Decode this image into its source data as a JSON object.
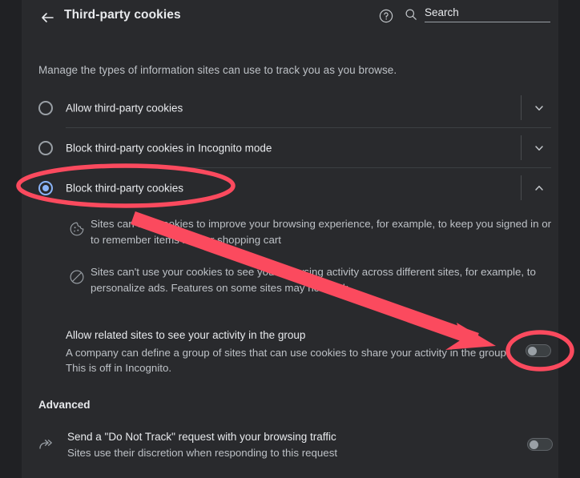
{
  "header": {
    "back_icon": "back-arrow-icon",
    "title": "Third-party cookies",
    "help_icon": "help-circle-icon",
    "search_icon": "search-icon",
    "search_placeholder": "Search",
    "search_value": ""
  },
  "intro": "Manage the types of information sites can use to track you as you browse.",
  "options": [
    {
      "label": "Allow third-party cookies",
      "selected": false,
      "expanded": false,
      "chevron": "chevron-down-icon"
    },
    {
      "label": "Block third-party cookies in Incognito mode",
      "selected": false,
      "expanded": false,
      "chevron": "chevron-down-icon"
    },
    {
      "label": "Block third-party cookies",
      "selected": true,
      "expanded": true,
      "chevron": "chevron-up-icon"
    }
  ],
  "details": [
    {
      "icon": "cookie-icon",
      "text": "Sites can use cookies to improve your browsing experience, for example, to keep you signed in or to remember items in your shopping cart"
    },
    {
      "icon": "block-circle-icon",
      "text": "Sites can't use your cookies to see your browsing activity across different sites, for example, to personalize ads. Features on some sites may not work."
    }
  ],
  "related_sites": {
    "title": "Allow related sites to see your activity in the group",
    "subtitle": "A company can define a group of sites that can use cookies to share your activity in the group. This is off in Incognito.",
    "toggle_state": "off"
  },
  "advanced": {
    "section_label": "Advanced",
    "items": [
      {
        "icon": "do-not-track-icon",
        "title": "Send a \"Do Not Track\" request with your browsing traffic",
        "subtitle": "Sites use their discretion when responding to this request",
        "toggle_state": "off"
      }
    ]
  },
  "annotations": {
    "highlight_color": "#fb4a5e",
    "ellipse_radio_label": "Block third-party cookies",
    "ellipse_toggle_label": "related-sites-toggle",
    "arrow_label": "arrow-pointing-to-related-sites-toggle"
  },
  "colors": {
    "rail_bg": "#202124",
    "pane_bg": "#292a2d",
    "text_primary": "#e8eaed",
    "text_secondary": "#bdc1c6",
    "accent_blue": "#8ab4f8",
    "annotation_red": "#fb4a5e"
  }
}
